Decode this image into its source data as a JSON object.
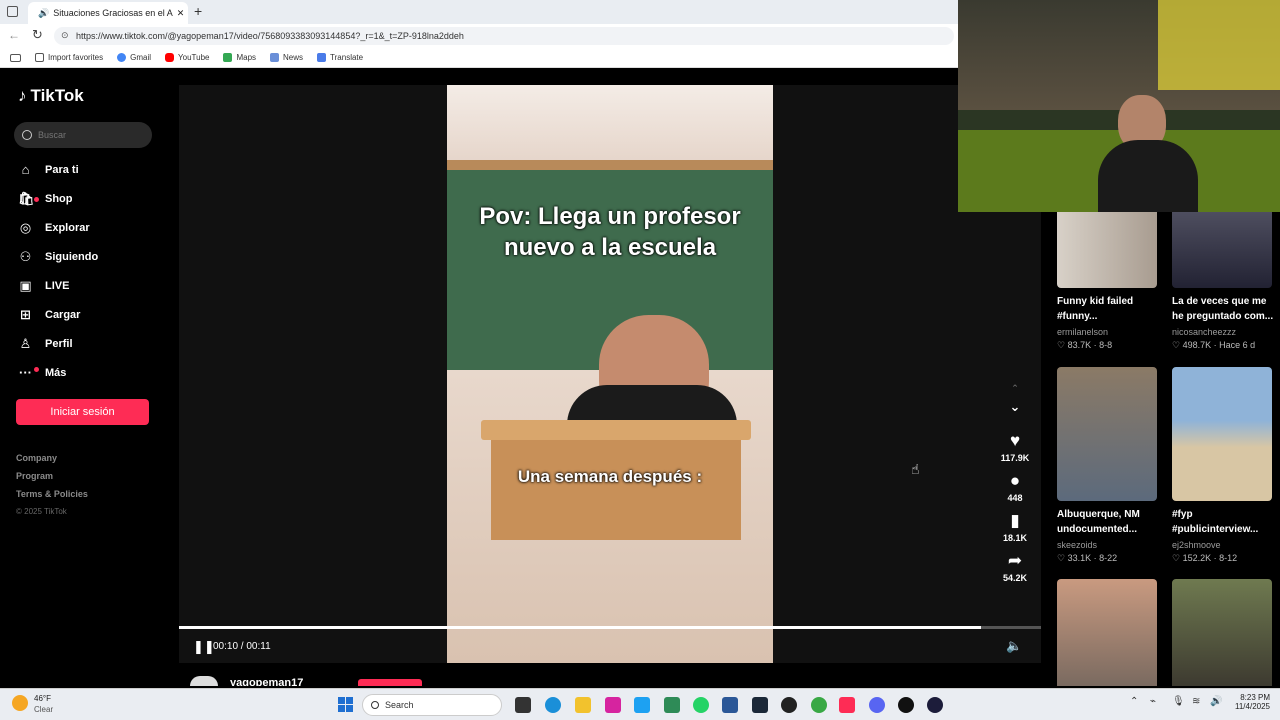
{
  "browser": {
    "tab_title": "Situaciones Graciosas en el A",
    "url": "https://www.tiktok.com/@yagopeman17/video/7568093383093144854?_r=1&_t=ZP-918lna2ddeh",
    "favorites": [
      "Import favorites",
      "Gmail",
      "YouTube",
      "Maps",
      "News",
      "Translate"
    ]
  },
  "tiktok": {
    "logo": "TikTok",
    "search_placeholder": "Buscar",
    "nav": [
      {
        "label": "Para ti",
        "icon": "home-icon"
      },
      {
        "label": "Shop",
        "icon": "shop-icon"
      },
      {
        "label": "Explorar",
        "icon": "compass-icon"
      },
      {
        "label": "Siguiendo",
        "icon": "person-icon"
      },
      {
        "label": "LIVE",
        "icon": "live-icon"
      },
      {
        "label": "Cargar",
        "icon": "upload-icon"
      },
      {
        "label": "Perfil",
        "icon": "profile-icon"
      },
      {
        "label": "Más",
        "icon": "more-icon"
      }
    ],
    "login_label": "Iniciar sesión",
    "footer": [
      "Company",
      "Program",
      "Terms & Policies"
    ],
    "copyright": "© 2025 TikTok"
  },
  "video": {
    "caption_top": "Pov: Llega un profesor nuevo a la escuela",
    "caption_bottom": "Una semana después :",
    "time_current": "00:10",
    "time_total": "00:11",
    "progress": 0.93,
    "author": "yagopeman17",
    "likes": "117.9K",
    "comments": "448",
    "saves": "18.1K",
    "shares": "54.2K"
  },
  "recommendations": [
    {
      "title": "Funny kid failed #funny...",
      "author": "ermilanelson",
      "likes": "83.7K",
      "date": "8-8"
    },
    {
      "title": "La de veces que me he preguntado com...",
      "author": "nicosancheezzz",
      "likes": "498.7K",
      "date": "Hace 6 d"
    },
    {
      "title": "Albuquerque, NM undocumented...",
      "author": "skeezoids",
      "likes": "33.1K",
      "date": "8-22"
    },
    {
      "title": "#fyp #publicinterview...",
      "author": "ej2shmoove",
      "likes": "152.2K",
      "date": "8-12"
    }
  ],
  "taskbar": {
    "weather_temp": "46°F",
    "weather_desc": "Clear",
    "search_label": "Search",
    "time": "8:23 PM",
    "date": "11/4/2025"
  },
  "colors": {
    "accent": "#fe2c55"
  }
}
